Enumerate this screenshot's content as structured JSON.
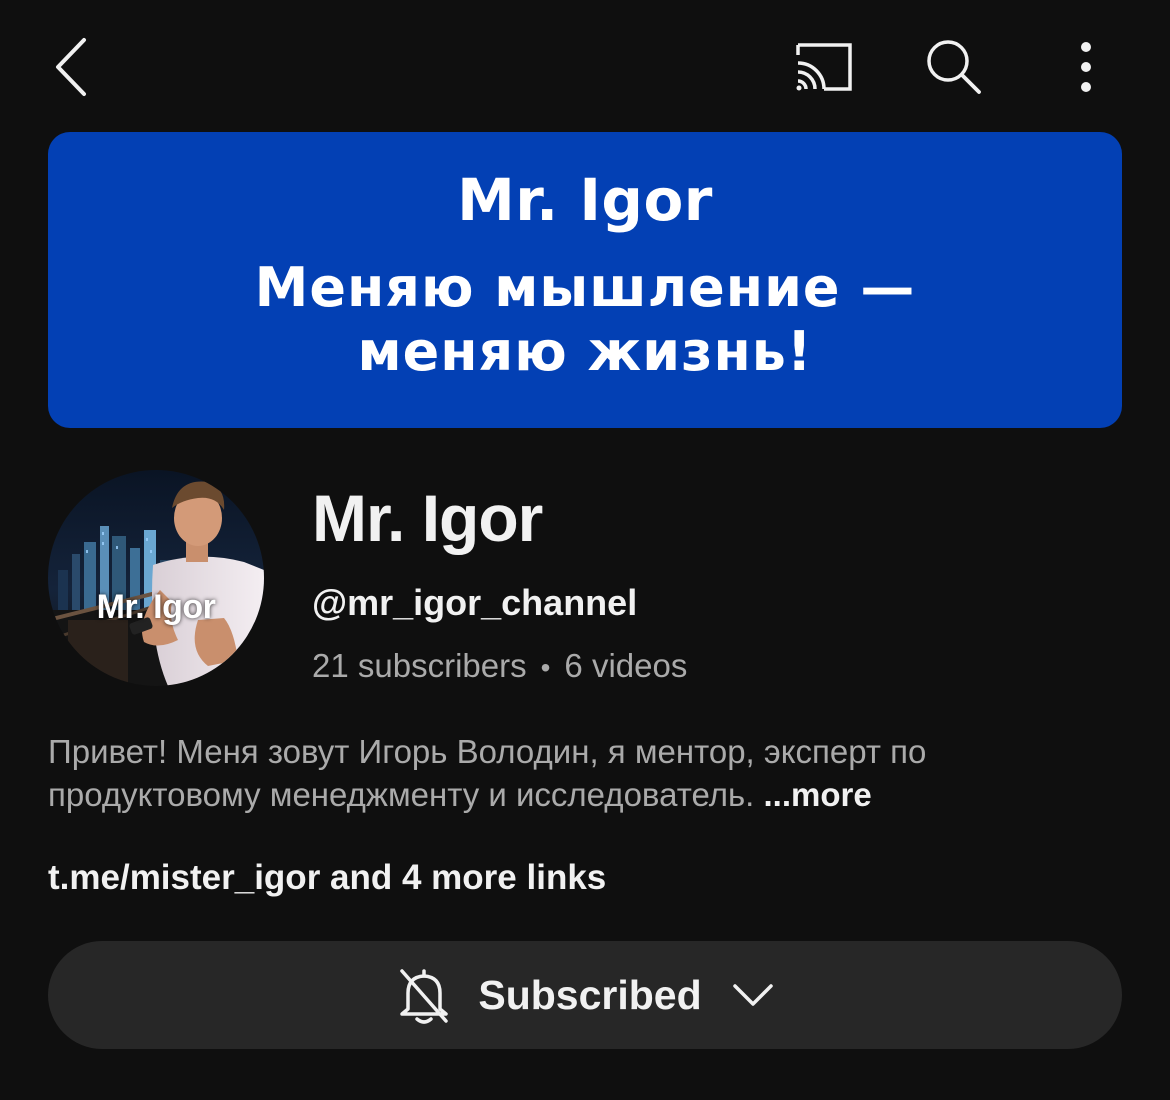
{
  "topbar": {
    "icons": [
      "back-icon",
      "cast-icon",
      "search-icon",
      "more-vert-icon"
    ]
  },
  "banner": {
    "title": "Mr. Igor",
    "slogan_line1": "Меняю мышление —",
    "slogan_line2": "меняю жизнь!",
    "color": "#0340b4"
  },
  "avatar": {
    "label": "Mr. Igor"
  },
  "channel": {
    "name": "Mr. Igor",
    "handle": "@mr_igor_channel",
    "subscribers": "21 subscribers",
    "separator": "•",
    "videos": "6 videos"
  },
  "description": {
    "text": "Привет! Меня зовут Игорь Володин, я ментор, эксперт по продуктовому менеджменту и исследователь.",
    "more": "...more"
  },
  "links": {
    "primary": "t.me/mister_igor",
    "rest": "and 4 more links"
  },
  "subscribe": {
    "label": "Subscribed",
    "icon": "bell-off-icon",
    "dropdown_icon": "chevron-down-icon"
  },
  "colors": {
    "background": "#0f0f0f",
    "button": "#272727",
    "secondary_text": "#aaaaaa",
    "primary_text": "#f1f1f1"
  }
}
